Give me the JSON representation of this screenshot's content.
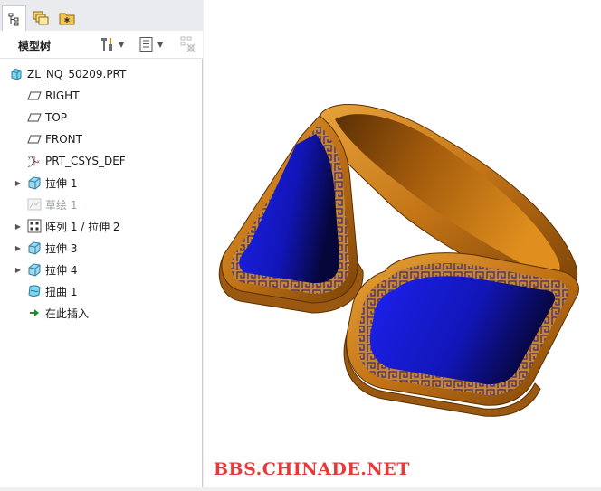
{
  "tabs": [
    {
      "name": "model-tree-tab-icon",
      "active": true
    },
    {
      "name": "layers-tab-icon",
      "active": false
    },
    {
      "name": "favorites-tab-icon",
      "active": false
    }
  ],
  "toolbar": {
    "title": "模型树",
    "buttons": [
      {
        "name": "settings-tools-icon"
      },
      {
        "name": "show-filter-icon"
      },
      {
        "name": "columns-disabled-icon"
      }
    ]
  },
  "tree": {
    "nodes": [
      {
        "label": "ZL_NQ_50209.PRT",
        "icon": "part-icon",
        "expandable": false,
        "disabled": false,
        "root": true
      },
      {
        "label": "RIGHT",
        "icon": "datum-plane-icon",
        "expandable": false,
        "disabled": false
      },
      {
        "label": "TOP",
        "icon": "datum-plane-icon",
        "expandable": false,
        "disabled": false
      },
      {
        "label": "FRONT",
        "icon": "datum-plane-icon",
        "expandable": false,
        "disabled": false
      },
      {
        "label": "PRT_CSYS_DEF",
        "icon": "coordinate-system-icon",
        "expandable": false,
        "disabled": false
      },
      {
        "label": "拉伸 1",
        "icon": "extrude-icon",
        "expandable": true,
        "disabled": false
      },
      {
        "label": "草绘 1",
        "icon": "sketch-icon",
        "expandable": false,
        "disabled": true
      },
      {
        "label": "阵列 1 / 拉伸 2",
        "icon": "pattern-icon",
        "expandable": true,
        "disabled": false
      },
      {
        "label": "拉伸 3",
        "icon": "extrude-icon",
        "expandable": true,
        "disabled": false
      },
      {
        "label": "拉伸 4",
        "icon": "extrude-icon",
        "expandable": true,
        "disabled": false
      },
      {
        "label": "扭曲 1",
        "icon": "warp-icon",
        "expandable": false,
        "disabled": false
      },
      {
        "label": "在此插入",
        "icon": "insert-here-arrow-icon",
        "expandable": false,
        "disabled": false
      }
    ]
  },
  "viewport": {
    "model_colors": {
      "gold": "#c8791a",
      "gold_dark": "#6b3a08",
      "blue": "#1418d8",
      "blue_dark": "#0a0a55"
    }
  },
  "watermark": "BBS.CHINADE.NET"
}
